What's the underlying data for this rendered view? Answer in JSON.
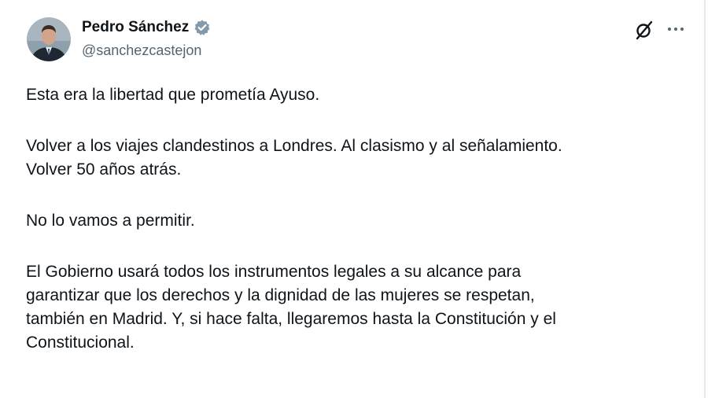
{
  "author": {
    "name": "Pedro Sánchez",
    "handle": "@sanchezcastejon",
    "verified": true,
    "avatar_icon": "profile-photo"
  },
  "toolbar": {
    "grok_icon": "grok-icon",
    "more_icon": "more-horizontal-icon"
  },
  "post": {
    "p1": "Esta era la libertad que prometía Ayuso.",
    "p2_line1": "Volver a los viajes clandestinos a Londres. Al clasismo y al señalamiento.",
    "p2_line2": "Volver 50 años atrás.",
    "p3": "No lo vamos a permitir.",
    "p4_line1": "El Gobierno usará todos los instrumentos legales a su alcance para",
    "p4_line2": "garantizar que los derechos y la dignidad de las mujeres se respetan,",
    "p4_line3": "también en Madrid. Y, si hace falta, llegaremos hasta la Constitución y el",
    "p4_line4": "Constitucional."
  },
  "colors": {
    "text": "#0f1419",
    "secondary": "#536471",
    "verified_badge": "#829aab"
  }
}
